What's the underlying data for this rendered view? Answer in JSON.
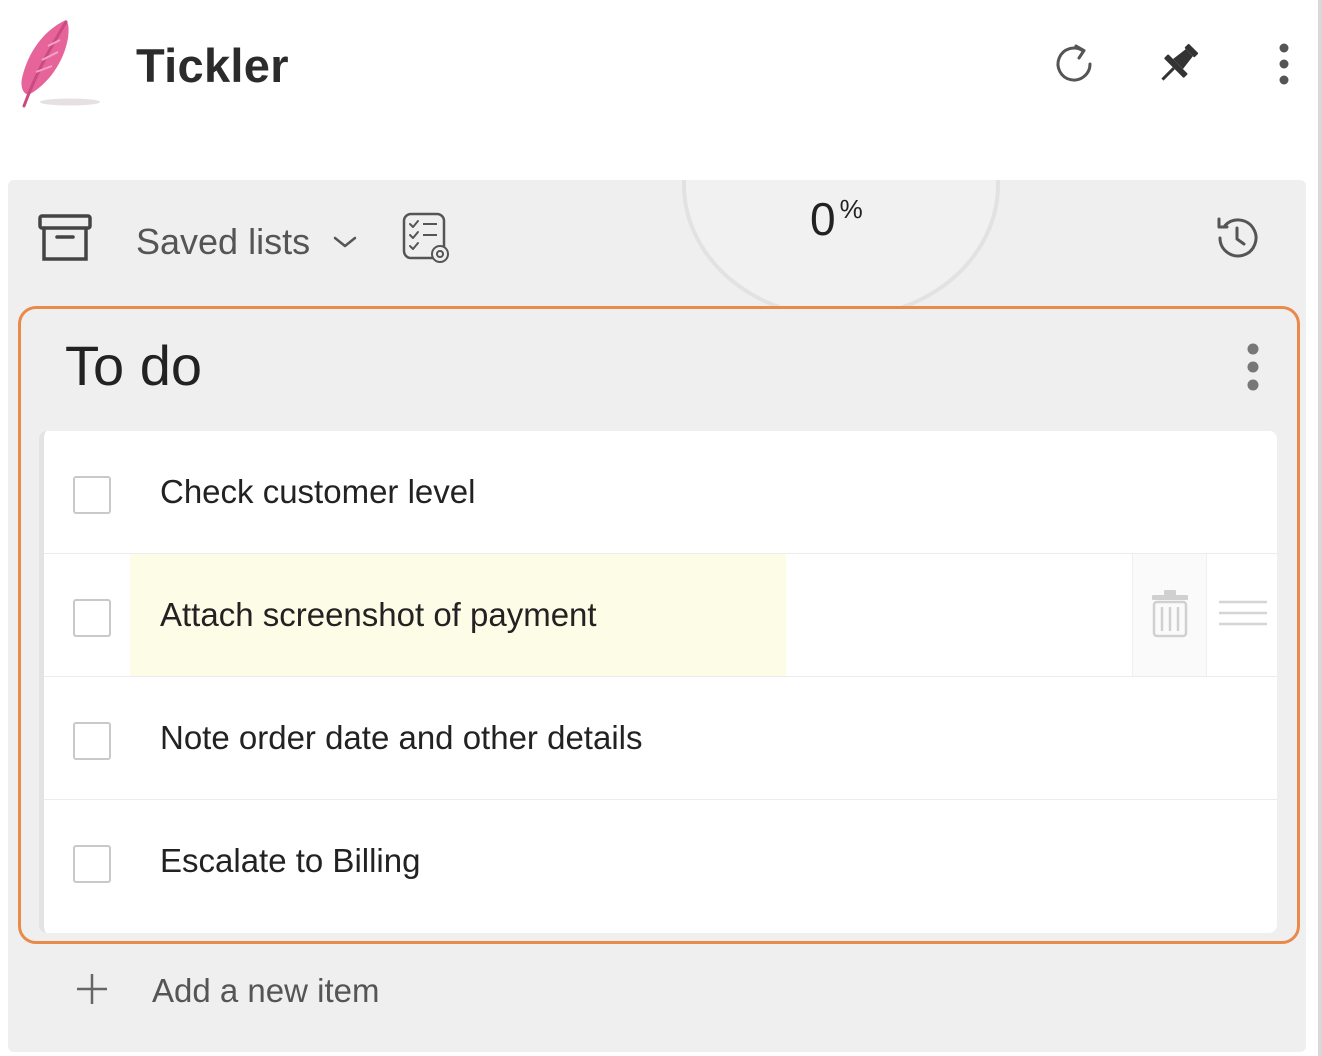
{
  "app": {
    "title": "Tickler",
    "icons": [
      "feather-logo",
      "refresh-icon",
      "pin-icon",
      "more-vertical-icon"
    ]
  },
  "toolbar": {
    "archive_icon": "archive-icon",
    "saved_lists_label": "Saved lists",
    "checklist_settings_icon": "checklist-settings-icon",
    "history_icon": "history-icon"
  },
  "progress": {
    "value": "0",
    "unit": "%",
    "fraction": 0
  },
  "list": {
    "title": "To do",
    "items": [
      {
        "label": "Check customer level",
        "checked": false
      },
      {
        "label": "Attach screenshot of payment",
        "checked": false,
        "highlighted": true
      },
      {
        "label": "Note order date and other details",
        "checked": false
      },
      {
        "label": "Escalate to Billing",
        "checked": false
      }
    ]
  },
  "add_item": {
    "label": "Add a new item"
  },
  "colors": {
    "accent_border": "#ea8a4a",
    "highlight": "#fdfce6",
    "logo": "#e7649a"
  }
}
